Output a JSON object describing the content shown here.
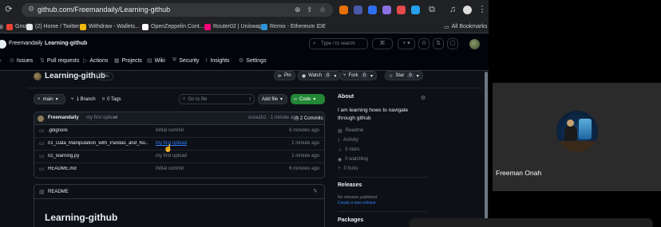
{
  "browser": {
    "url": "github.com/Freemandaily/Learning-github",
    "bookmarks": [
      {
        "label": "Gmail",
        "color": "#ea4335"
      },
      {
        "label": "(2) Home / Twitter",
        "color": "#e7e9ea"
      },
      {
        "label": "Withdraw - Wallets...",
        "color": "#f0b90b"
      },
      {
        "label": "OpenZeppelin Cont...",
        "color": "#ffffff"
      },
      {
        "label": "Router02 | Uniswap",
        "color": "#ff007a"
      },
      {
        "label": "Remix - Ethereum IDE",
        "color": "#2b94d6"
      }
    ],
    "all_bookmarks": "All Bookmarks"
  },
  "github": {
    "owner": "Freemandaily",
    "repo": "Learning-github",
    "search_placeholder": "Type / to search",
    "tabs": [
      "Issues",
      "Pull requests",
      "Actions",
      "Projects",
      "Wiki",
      "Security",
      "Insights",
      "Settings"
    ],
    "visibility": "Public",
    "pin_label": "Pin",
    "watch_label": "Watch",
    "watch_count": "0",
    "fork_label": "Fork",
    "fork_count": "0",
    "star_label": "Star",
    "star_count": "0",
    "branch": "main",
    "branch_count": "1 Branch",
    "tag_count": "0 Tags",
    "goto_file": "Go to file",
    "add_file": "Add file",
    "code_button": "Code",
    "commit": {
      "author": "Freemandaily",
      "message": "my first upload",
      "hash_time": "xcoa1b1 · 1 minute ago",
      "commits": "2 Commits"
    },
    "files": [
      {
        "name": ".gitignore",
        "message": "Initial commit",
        "time": "6 minutes ago",
        "link": false
      },
      {
        "name": "01_Data_Manipulation_with_Pandas_and_Nu...",
        "message": "my first upload",
        "time": "1 minute ago",
        "link": true
      },
      {
        "name": "02_learning.py",
        "message": "my first upload",
        "time": "1 minute ago",
        "link": false
      },
      {
        "name": "README.md",
        "message": "Initial commit",
        "time": "6 minutes ago",
        "link": false
      }
    ],
    "readme_label": "README",
    "readme_title": "Learning-github",
    "about": {
      "heading": "About",
      "description": "I am learning hows to navigate through github",
      "readme": "Readme",
      "activity": "Activity",
      "stars": "0 stars",
      "watching": "0 watching",
      "forks": "0 forks",
      "releases_heading": "Releases",
      "releases_none": "No releases published",
      "create_release": "Create a new release",
      "packages_heading": "Packages"
    }
  },
  "meeting": {
    "participant_name": "Freeman Onah"
  },
  "colors": {
    "code_button_bg": "#238636",
    "link": "#2f81f7",
    "page_bg": "#0d1117"
  }
}
